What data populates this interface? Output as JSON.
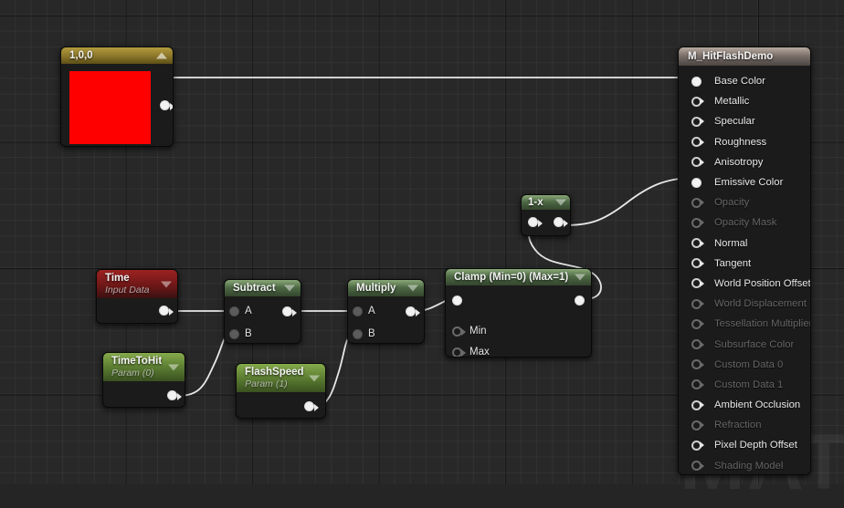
{
  "app": {
    "watermark": "MAT"
  },
  "nodes": {
    "constant": {
      "title": "1,0,0",
      "swatch_color": "#fe0000",
      "caret": "collapse-up-arrow"
    },
    "material": {
      "title": "M_HitFlashDemo",
      "inputs": [
        {
          "label": "Base Color",
          "pin": "filled",
          "enabled": true,
          "connected": true
        },
        {
          "label": "Metallic",
          "pin": "hollow",
          "enabled": true,
          "connected": false
        },
        {
          "label": "Specular",
          "pin": "hollow",
          "enabled": true,
          "connected": false
        },
        {
          "label": "Roughness",
          "pin": "hollow",
          "enabled": true,
          "connected": false
        },
        {
          "label": "Anisotropy",
          "pin": "hollow",
          "enabled": true,
          "connected": false
        },
        {
          "label": "Emissive Color",
          "pin": "filled",
          "enabled": true,
          "connected": true
        },
        {
          "label": "Opacity",
          "pin": "hollow",
          "enabled": false,
          "connected": false
        },
        {
          "label": "Opacity Mask",
          "pin": "hollow",
          "enabled": false,
          "connected": false
        },
        {
          "label": "Normal",
          "pin": "hollow",
          "enabled": true,
          "connected": false
        },
        {
          "label": "Tangent",
          "pin": "hollow",
          "enabled": true,
          "connected": false
        },
        {
          "label": "World Position Offset",
          "pin": "hollow",
          "enabled": true,
          "connected": false
        },
        {
          "label": "World Displacement",
          "pin": "hollow",
          "enabled": false,
          "connected": false
        },
        {
          "label": "Tessellation Multiplier",
          "pin": "hollow",
          "enabled": false,
          "connected": false
        },
        {
          "label": "Subsurface Color",
          "pin": "hollow",
          "enabled": false,
          "connected": false
        },
        {
          "label": "Custom Data 0",
          "pin": "hollow",
          "enabled": false,
          "connected": false
        },
        {
          "label": "Custom Data 1",
          "pin": "hollow",
          "enabled": false,
          "connected": false
        },
        {
          "label": "Ambient Occlusion",
          "pin": "hollow",
          "enabled": true,
          "connected": false
        },
        {
          "label": "Refraction",
          "pin": "hollow",
          "enabled": false,
          "connected": false
        },
        {
          "label": "Pixel Depth Offset",
          "pin": "hollow",
          "enabled": true,
          "connected": false
        },
        {
          "label": "Shading Model",
          "pin": "hollow",
          "enabled": false,
          "connected": false
        }
      ]
    },
    "time": {
      "title": "Time",
      "subtitle": "Input Data"
    },
    "time_to_hit": {
      "title": "TimeToHit",
      "subtitle": "Param (0)"
    },
    "flash_speed": {
      "title": "FlashSpeed",
      "subtitle": "Param (1)"
    },
    "subtract": {
      "title": "Subtract",
      "input_a": "A",
      "input_b": "B"
    },
    "multiply": {
      "title": "Multiply",
      "input_a": "A",
      "input_b": "B"
    },
    "clamp": {
      "title": "Clamp (Min=0) (Max=1)",
      "input_min": "Min",
      "input_max": "Max"
    },
    "one_minus": {
      "title": "1-x"
    }
  },
  "colors": {
    "canvas_bg": "#282828",
    "node_bg": "#1b1b1b",
    "wire": "#e8e8e8",
    "header_math": "#4e6a45",
    "header_param": "#5d7f33",
    "header_time": "#6e1717",
    "header_const": "#8a7529",
    "header_material": "#7c706a",
    "constant_value": "#fe0000"
  }
}
